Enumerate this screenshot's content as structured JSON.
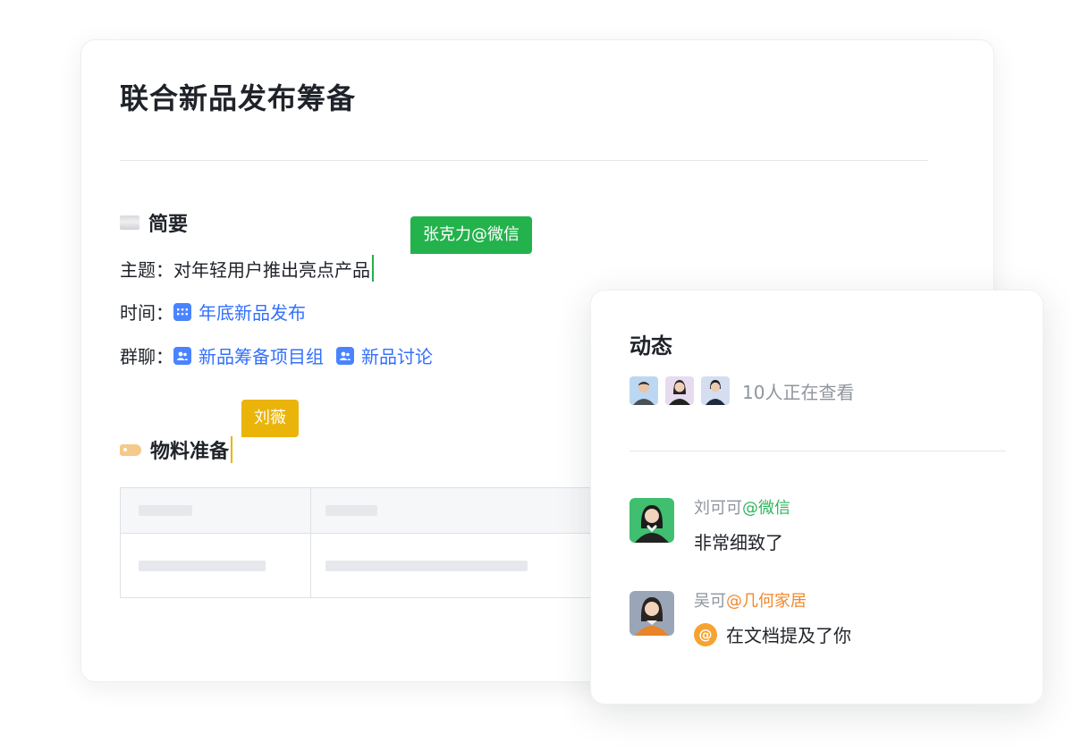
{
  "document": {
    "title": "联合新品发布筹备",
    "brief": {
      "heading": "简要",
      "heading_emoji": "scroll-emoji",
      "theme_label": "主题：",
      "theme_value": "对年轻用户推出亮点产品",
      "time_label": "时间：",
      "time_link": "年底新品发布",
      "time_link_icon": "calendar-icon",
      "group_label": "群聊：",
      "group_links": [
        "新品筹备项目组",
        "新品讨论"
      ],
      "group_link_icon": "group-chat-icon"
    },
    "materials": {
      "heading": "物料准备",
      "heading_emoji": "tag-emoji"
    }
  },
  "collaborators": [
    {
      "name": "张克力@微信",
      "color": "#24b24c"
    },
    {
      "name": "刘薇",
      "color": "#eab40a"
    }
  ],
  "feed": {
    "title": "动态",
    "viewers_text": "10人正在查看",
    "items": [
      {
        "user": "刘可可",
        "org": "@微信",
        "org_color": "#2fb65d",
        "message": "非常细致了"
      },
      {
        "user": "吴可",
        "org": "@几何家居",
        "org_color": "#f0882c",
        "message": "在文档提及了你",
        "badge": "@"
      }
    ]
  },
  "colors": {
    "link": "#3370ff",
    "accent_green": "#24b24c",
    "accent_yellow": "#eab40a"
  }
}
